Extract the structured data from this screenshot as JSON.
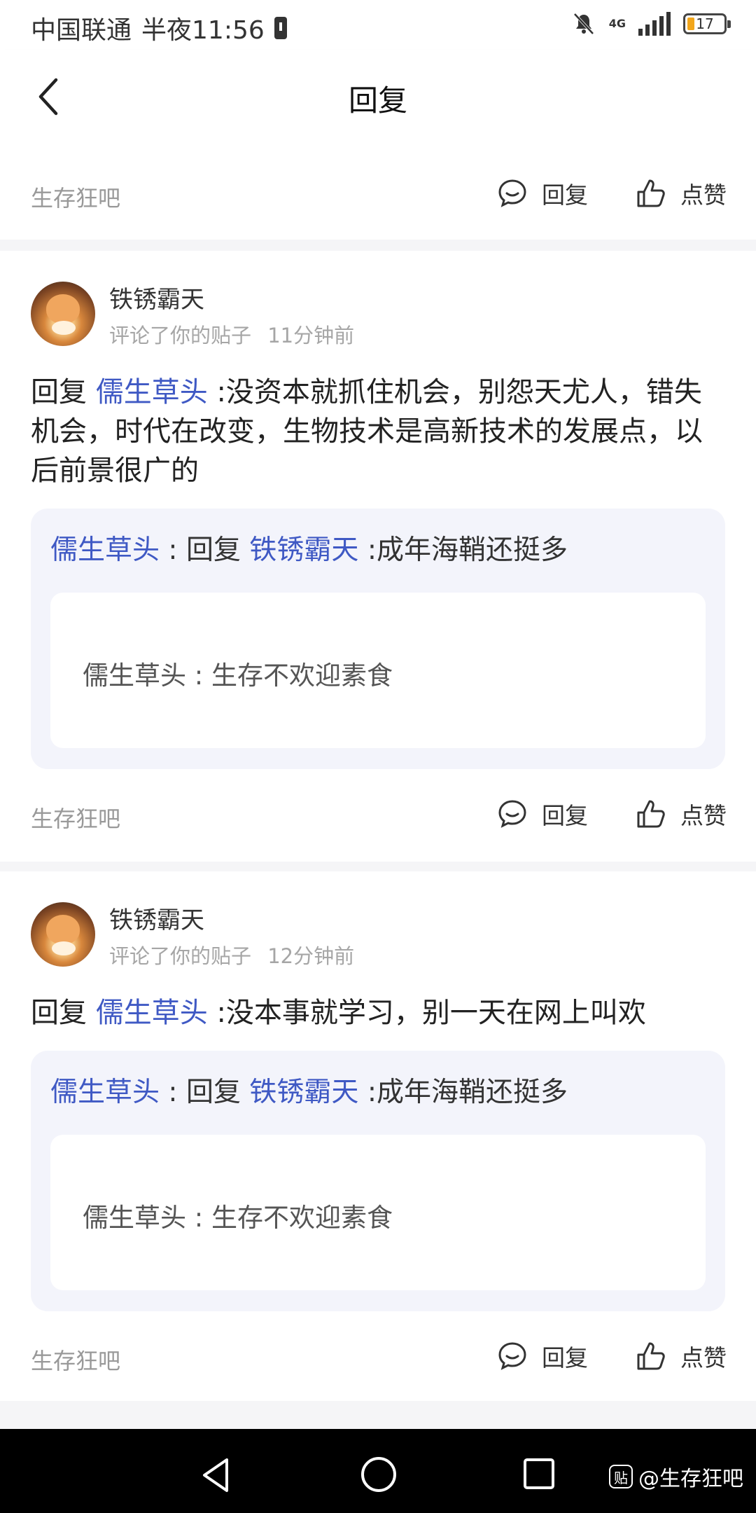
{
  "status": {
    "carrier": "中国联通",
    "time": "半夜11:56",
    "network": "4G",
    "battery": "17"
  },
  "header": {
    "title": "回复"
  },
  "top_card": {
    "forum": "生存狂吧",
    "reply_label": "回复",
    "like_label": "点赞"
  },
  "posts": [
    {
      "username": "铁锈霸天",
      "meta": "评论了你的贴子",
      "time_ago": "11分钟前",
      "reply_prefix": "回复",
      "reply_target": "儒生草头",
      "content": ":没资本就抓住机会，别怨天尤人，错失机会，时代在改变，生物技术是高新技术的发展点，以后前景很广的",
      "quote": {
        "author": "儒生草头",
        "sep": ":",
        "reply_word": "回复",
        "target": "铁锈霸天",
        "text": ":成年海鞘还挺多",
        "inner_author": "儒生草头",
        "inner_text": " : 生存不欢迎素食"
      },
      "forum": "生存狂吧",
      "reply_label": "回复",
      "like_label": "点赞"
    },
    {
      "username": "铁锈霸天",
      "meta": "评论了你的贴子",
      "time_ago": "12分钟前",
      "reply_prefix": "回复",
      "reply_target": "儒生草头",
      "content": ":没本事就学习，别一天在网上叫欢",
      "quote": {
        "author": "儒生草头",
        "sep": ":",
        "reply_word": "回复",
        "target": "铁锈霸天",
        "text": ":成年海鞘还挺多",
        "inner_author": "儒生草头",
        "inner_text": " : 生存不欢迎素食"
      },
      "forum": "生存狂吧",
      "reply_label": "回复",
      "like_label": "点赞"
    }
  ],
  "watermark": {
    "icon": "贴",
    "text": "@生存狂吧"
  }
}
